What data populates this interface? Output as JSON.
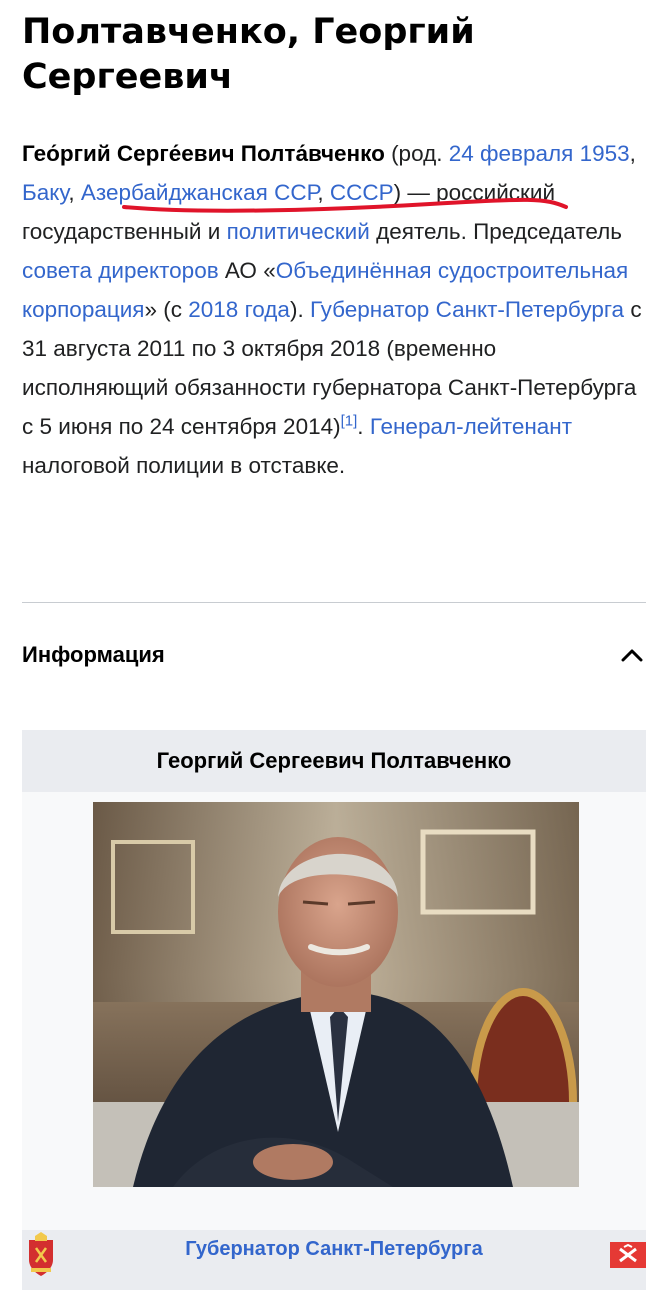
{
  "article": {
    "title": "Полтавченко, Георгий Сергеевич",
    "lead": {
      "name_bold": "Гео́ргий Серге́евич Полта́вченко",
      "t1": " (род. ",
      "birth_date_link": "24 февраля",
      "t2": " ",
      "birth_year_link": "1953",
      "t3": ", ",
      "city_link": "Баку",
      "t4": ", ",
      "republic_link": "Азербайджанская ССР",
      "t5": ", ",
      "country_link": "СССР",
      "t6": ") — российский государственный и ",
      "political_link": "политический",
      "t7": " деятель. Председатель ",
      "board_link": "совета директоров",
      "t8": " АО «",
      "corp_link": "Объединённая судостроительная корпорация",
      "t9": "» (с ",
      "year2018_link": "2018 года",
      "t10": "). ",
      "governor_link": "Губернатор Санкт-Петербурга",
      "t11": " с 31 августа 2011 по 3 октября 2018 (временно исполняющий обязанности губернатора Санкт-Петербурга с 5 июня по 24 сентября 2014)",
      "ref": "[1]",
      "t12": ". ",
      "rank_link": "Генерал-лейтенант",
      "t13": " налоговой полиции в отставке."
    }
  },
  "section": {
    "title": "Информация",
    "collapse_icon": "chevron-up-icon"
  },
  "infobox": {
    "heading": "Георгий Сергеевич Полтавченко",
    "photo_icon": "portrait-photo",
    "footer_label": "Губернатор Санкт-Петербурга",
    "left_emblem": "coat-of-arms-icon",
    "right_emblem": "flag-icon"
  },
  "colors": {
    "link": "#3366cc",
    "text": "#202122",
    "annotation": "#e0142a",
    "infobox_header": "#eaecf0"
  }
}
